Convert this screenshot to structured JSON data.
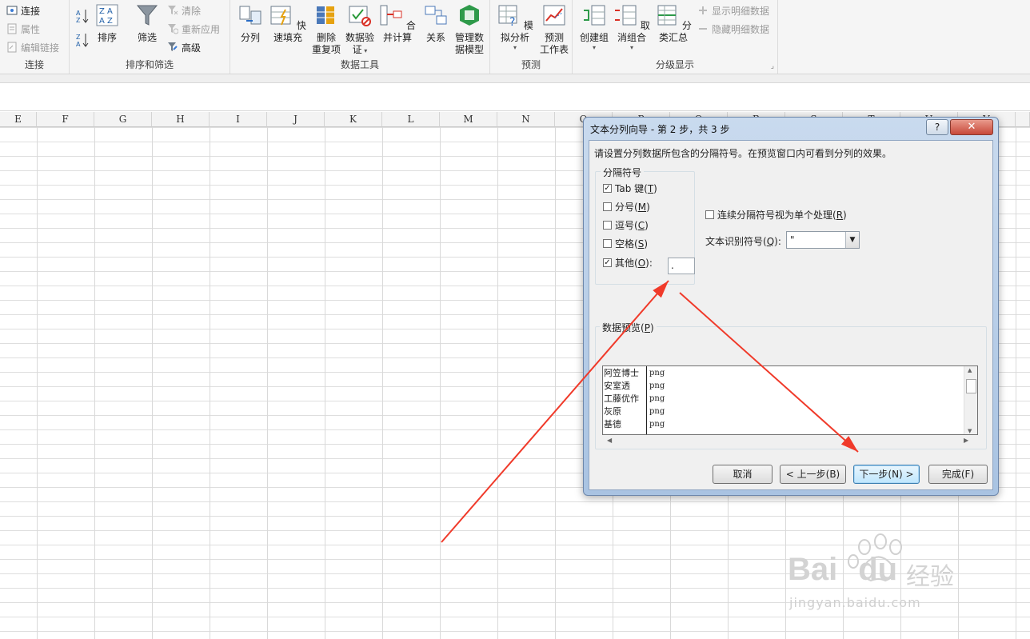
{
  "ribbon": {
    "connections": {
      "items": [
        "连接",
        "属性",
        "编辑链接"
      ],
      "label": "连接"
    },
    "sort_filter": {
      "sort_label": "排序",
      "filter_label": "筛选",
      "clear_label": "清除",
      "reapply_label": "重新应用",
      "advanced_label": "高级",
      "label": "排序和筛选"
    },
    "data_tools": {
      "text_to_columns": "分列",
      "flash_fill": "快速填充",
      "remove_dup_line1": "删除",
      "remove_dup_line2": "重复项",
      "validation_line1": "数据验",
      "validation_line2": "证",
      "consolidate": "合并计算",
      "relationships": "关系",
      "manage_model_line1": "管理数",
      "manage_model_line2": "据模型",
      "label": "数据工具"
    },
    "forecast": {
      "whatif": "模拟分析",
      "sheet_line1": "预测",
      "sheet_line2": "工作表",
      "label": "预测"
    },
    "outline": {
      "group": "创建组",
      "ungroup": "取消组合",
      "subtotal": "分类汇总",
      "show_detail": "显示明细数据",
      "hide_detail": "隐藏明细数据",
      "label": "分级显示"
    }
  },
  "sheet": {
    "columns": [
      "E",
      "F",
      "G",
      "H",
      "I",
      "J",
      "K",
      "L",
      "M",
      "N",
      "O",
      "P",
      "Q",
      "R",
      "S",
      "T",
      "U",
      "V"
    ]
  },
  "dialog": {
    "title": "文本分列向导 - 第 2 步，共 3 步",
    "help_glyph": "?",
    "close_glyph": "✕",
    "description": "请设置分列数据所包含的分隔符号。在预览窗口内可看到分列的效果。",
    "delimiters_legend": "分隔符号",
    "delimiters": [
      {
        "label": "Tab 键",
        "key": "T",
        "checked": true
      },
      {
        "label": "分号",
        "key": "M",
        "checked": false
      },
      {
        "label": "逗号",
        "key": "C",
        "checked": false
      },
      {
        "label": "空格",
        "key": "S",
        "checked": false
      },
      {
        "label": "其他",
        "key": "O",
        "checked": true
      }
    ],
    "other_value": ".",
    "consecutive_label": "连续分隔符号视为单个处理",
    "consecutive_key": "R",
    "consecutive_checked": false,
    "qualifier_label": "文本识别符号",
    "qualifier_key": "Q",
    "qualifier_value": "\"",
    "preview_label": "数据预览",
    "preview_key": "P",
    "preview_rows": [
      [
        "阿笠博士",
        "png"
      ],
      [
        "安室透",
        "png"
      ],
      [
        "工藤优作",
        "png"
      ],
      [
        "灰原",
        "png"
      ],
      [
        "基德",
        "png"
      ]
    ],
    "buttons": {
      "cancel": "取消",
      "back": "< 上一步(B)",
      "next": "下一步(N) >",
      "finish": "完成(F)"
    }
  },
  "watermark": {
    "brand": "Bai",
    "brand2": "du",
    "cn": "经验",
    "url": "jingyan.baidu.com"
  },
  "colors": {
    "annotation_arrow": "#f03a2a",
    "dialog_frame": "#a9c3e2"
  }
}
